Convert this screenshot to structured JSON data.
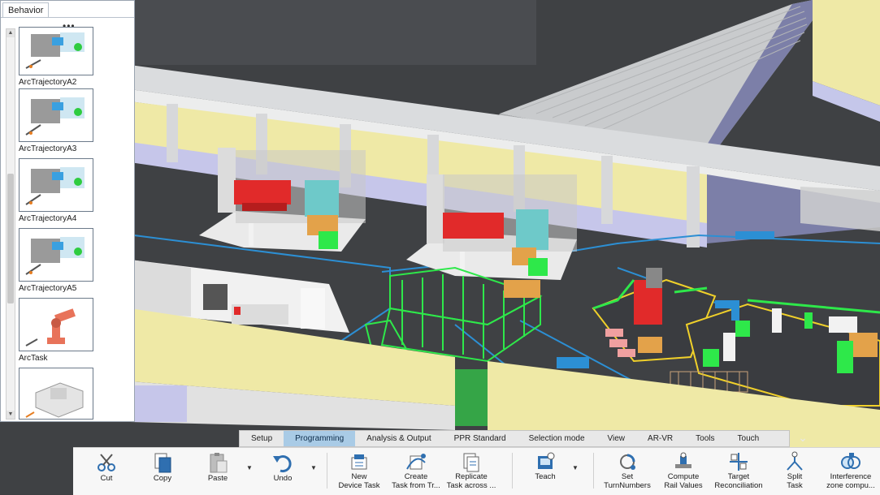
{
  "behavior_panel": {
    "tab_label": "Behavior",
    "items": [
      {
        "label": "ArcTrajectoryA2"
      },
      {
        "label": "ArcTrajectoryA3"
      },
      {
        "label": "ArcTrajectoryA4"
      },
      {
        "label": "ArcTrajectoryA5"
      },
      {
        "label": "ArcTask"
      },
      {
        "label": ""
      }
    ],
    "menu_icon": "ellipsis-icon"
  },
  "ribbon": {
    "tabs": [
      {
        "label": "Setup"
      },
      {
        "label": "Programming"
      },
      {
        "label": "Analysis & Output"
      },
      {
        "label": "PPR Standard"
      },
      {
        "label": "Selection mode"
      },
      {
        "label": "View"
      },
      {
        "label": "AR-VR"
      },
      {
        "label": "Tools"
      },
      {
        "label": "Touch"
      }
    ],
    "active_tab": "Programming",
    "tools": [
      {
        "line1": "Cut",
        "line2": "",
        "icon": "scissors-icon"
      },
      {
        "line1": "Copy",
        "line2": "",
        "icon": "copy-icon"
      },
      {
        "line1": "Paste",
        "line2": "",
        "icon": "paste-icon"
      },
      {
        "line1": "Undo",
        "line2": "",
        "icon": "undo-icon"
      },
      {
        "line1": "New",
        "line2": "Device Task",
        "icon": "new-device-task-icon"
      },
      {
        "line1": "Create",
        "line2": "Task from Tr...",
        "icon": "create-task-icon"
      },
      {
        "line1": "Replicate",
        "line2": "Task across ...",
        "icon": "replicate-task-icon"
      },
      {
        "line1": "Teach",
        "line2": "",
        "icon": "teach-icon"
      },
      {
        "line1": "Set",
        "line2": "TurnNumbers",
        "icon": "set-turn-numbers-icon"
      },
      {
        "line1": "Compute",
        "line2": "Rail Values",
        "icon": "compute-rail-icon"
      },
      {
        "line1": "Target",
        "line2": "Reconciliation",
        "icon": "target-reconciliation-icon"
      },
      {
        "line1": "Split",
        "line2": "Task",
        "icon": "split-task-icon"
      },
      {
        "line1": "Interference",
        "line2": "zone compu...",
        "icon": "interference-zone-icon"
      }
    ]
  },
  "colors": {
    "accent_tab": "#a9cbe6",
    "icon_blue": "#2f6fb0",
    "floor": "#3d3f42",
    "wall_cream": "#efe9a6",
    "safety_green": "#2ee84a",
    "machine_red": "#e12a2a"
  }
}
